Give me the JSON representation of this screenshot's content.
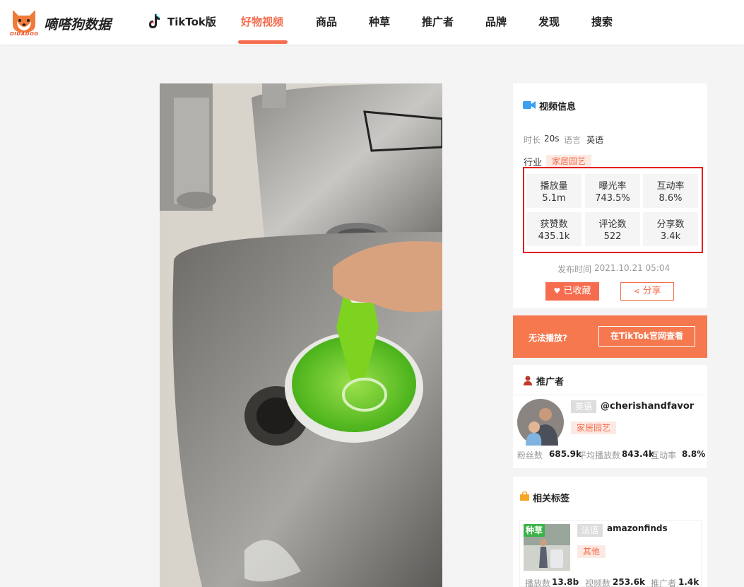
{
  "brand": {
    "name": "嘀嗒狗数据",
    "sub": "DIDADOG"
  },
  "nav": {
    "tiktok": "TikTok版",
    "items": [
      "好物视频",
      "商品",
      "种草",
      "推广者",
      "品牌",
      "发现",
      "搜索"
    ],
    "active": "好物视频"
  },
  "video_info": {
    "title": "视频信息",
    "duration_label": "时长",
    "duration": "20s",
    "language_label": "语言",
    "language": "英语",
    "industry_label": "行业",
    "industry": "家居园艺",
    "stats": [
      {
        "label": "播放量",
        "value": "5.1m"
      },
      {
        "label": "曝光率",
        "value": "743.5%"
      },
      {
        "label": "互动率",
        "value": "8.6%"
      },
      {
        "label": "获赞数",
        "value": "435.1k"
      },
      {
        "label": "评论数",
        "value": "522"
      },
      {
        "label": "分享数",
        "value": "3.4k"
      }
    ],
    "publish_label": "发布时间",
    "publish_time": "2021.10.21 05:04",
    "fav_button": "已收藏",
    "share_button": "分享"
  },
  "cta": {
    "text": "无法播放?",
    "button": "在TikTok官网查看"
  },
  "promoter": {
    "title": "推广者",
    "language": "英语",
    "handle": "@cherishandfavor",
    "category": "家居园艺",
    "fans_label": "粉丝数",
    "fans": "685.9k",
    "avg_play_label": "平均播放数",
    "avg_play": "843.4k",
    "engagement_label": "互动率",
    "engagement": "8.8%"
  },
  "related_tags": {
    "title": "相关标签",
    "badge": "种草",
    "language": "法语",
    "name": "amazonfinds",
    "category": "其他",
    "play_label": "播放数",
    "play": "13.8b",
    "video_label": "视频数",
    "video": "253.6k",
    "promoter_label": "推广者",
    "promoter": "1.4k"
  },
  "colors": {
    "accent": "#f56d4e",
    "highlight_border": "#e02020"
  }
}
